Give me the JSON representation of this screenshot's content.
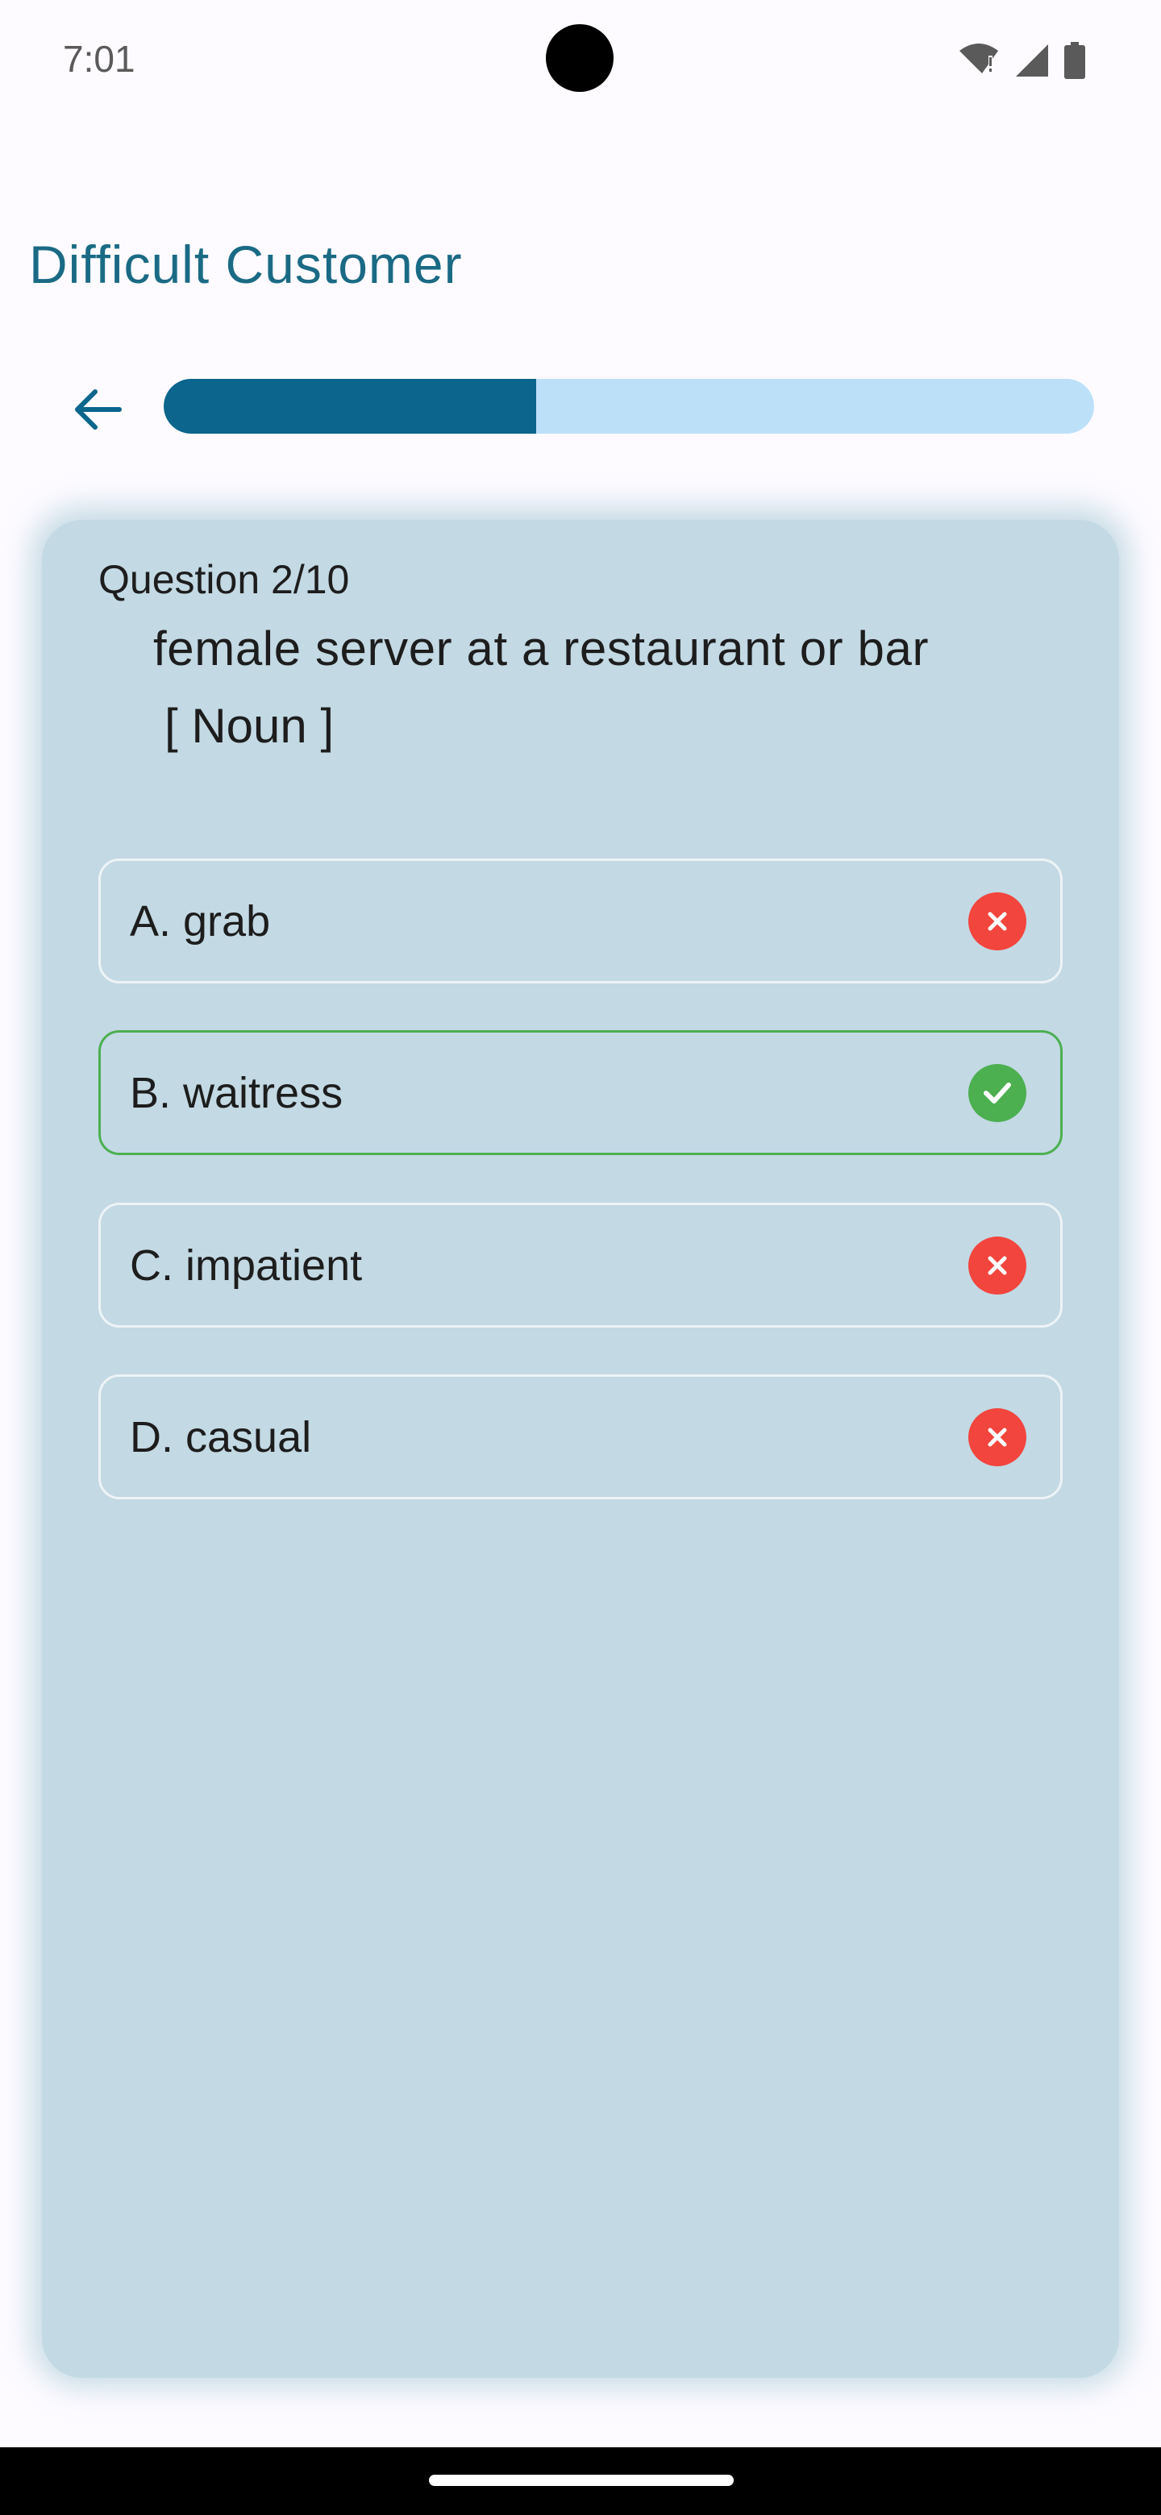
{
  "status_bar": {
    "time": "7:01",
    "icons": [
      "wifi-alert-icon",
      "signal-icon",
      "battery-icon"
    ]
  },
  "header": {
    "title": "Difficult Customer"
  },
  "progress": {
    "fraction": 0.4
  },
  "question": {
    "counter": "Question 2/10",
    "text": "female server at a restaurant or bar",
    "part_of_speech": "[ Noun ]"
  },
  "options": [
    {
      "label": "A. grab",
      "state": "wrong",
      "icon": "close-icon"
    },
    {
      "label": "B. waitress",
      "state": "correct",
      "icon": "check-icon"
    },
    {
      "label": "C. impatient",
      "state": "wrong",
      "icon": "close-icon"
    },
    {
      "label": "D. casual",
      "state": "wrong",
      "icon": "close-icon"
    }
  ],
  "colors": {
    "title": "#1b6a85",
    "progress_fill": "#0b658c",
    "progress_track": "#bde0f9",
    "card": "#c3d9e4",
    "correct": "#4caf50",
    "wrong": "#f2453d"
  }
}
